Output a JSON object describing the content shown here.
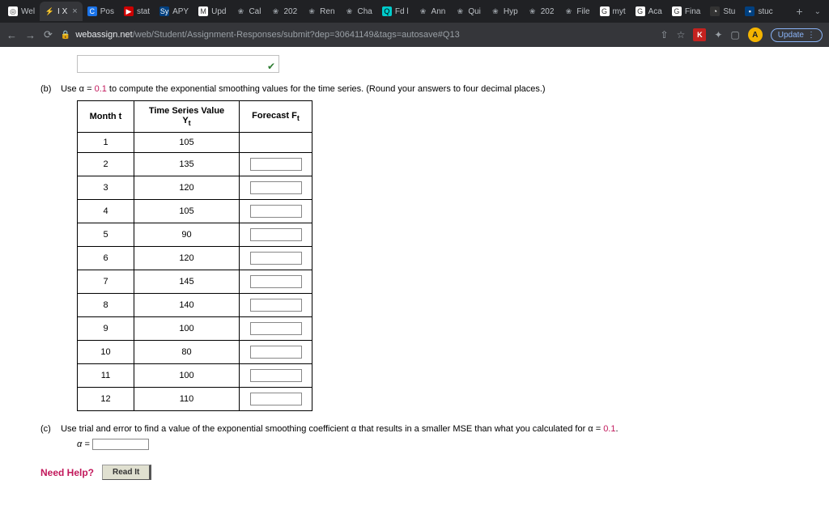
{
  "tabs": [
    {
      "fav": "fav-white",
      "icon": "◎",
      "label": "Wel",
      "active": false,
      "close": false
    },
    {
      "fav": "fav-none",
      "icon": "⚡",
      "label": "I X",
      "active": true,
      "close": true
    },
    {
      "fav": "fav-blue",
      "icon": "C",
      "label": "Pos",
      "active": false,
      "close": false
    },
    {
      "fav": "fav-red",
      "icon": "▶",
      "label": "stat",
      "active": false,
      "close": false
    },
    {
      "fav": "fav-navy",
      "icon": "Sy",
      "label": "APY",
      "active": false,
      "close": false
    },
    {
      "fav": "fav-white",
      "icon": "M",
      "label": "Upd",
      "active": false,
      "close": false
    },
    {
      "fav": "fav-none",
      "icon": "❀",
      "label": "Cal",
      "active": false,
      "close": false
    },
    {
      "fav": "fav-none",
      "icon": "❀",
      "label": "202",
      "active": false,
      "close": false
    },
    {
      "fav": "fav-none",
      "icon": "❀",
      "label": "Ren",
      "active": false,
      "close": false
    },
    {
      "fav": "fav-none",
      "icon": "❀",
      "label": "Cha",
      "active": false,
      "close": false
    },
    {
      "fav": "fav-cyan",
      "icon": "Q",
      "label": "Fd l",
      "active": false,
      "close": false
    },
    {
      "fav": "fav-none",
      "icon": "❀",
      "label": "Ann",
      "active": false,
      "close": false
    },
    {
      "fav": "fav-none",
      "icon": "❀",
      "label": "Qui",
      "active": false,
      "close": false
    },
    {
      "fav": "fav-none",
      "icon": "❀",
      "label": "Hyp",
      "active": false,
      "close": false
    },
    {
      "fav": "fav-none",
      "icon": "❀",
      "label": "202",
      "active": false,
      "close": false
    },
    {
      "fav": "fav-none",
      "icon": "❀",
      "label": "File",
      "active": false,
      "close": false
    },
    {
      "fav": "fav-white",
      "icon": "G",
      "label": "myt",
      "active": false,
      "close": false
    },
    {
      "fav": "fav-white",
      "icon": "G",
      "label": "Aca",
      "active": false,
      "close": false
    },
    {
      "fav": "fav-white",
      "icon": "G",
      "label": "Fina",
      "active": false,
      "close": false
    },
    {
      "fav": "fav-dark",
      "icon": "◔",
      "label": "Stu",
      "active": false,
      "close": false
    },
    {
      "fav": "fav-navy",
      "icon": "▪",
      "label": "stuc",
      "active": false,
      "close": false
    }
  ],
  "newtab": "+",
  "chevron": "⌄",
  "nav": {
    "back": "←",
    "forward": "→",
    "reload": "⟳"
  },
  "url": {
    "lock": "🔒",
    "host": "webassign.net",
    "path": "/web/Student/Assignment-Responses/submit?dep=30641149&tags=autosave#Q13"
  },
  "toolbar": {
    "share": "⇧",
    "star": "☆",
    "ext": "K",
    "puzzle": "✦",
    "window": "▢",
    "profile": "A",
    "update": "Update",
    "menu": "⋮"
  },
  "partb": {
    "label": "(b)",
    "text_pre": "Use α = ",
    "alpha": "0.1",
    "text_post": " to compute the exponential smoothing values for the time series. (Round your answers to four decimal places.)",
    "headers": {
      "month": "Month t",
      "value_l1": "Time Series Value",
      "value_l2": "Y",
      "value_sub": "t",
      "forecast": "Forecast F",
      "forecast_sub": "t"
    },
    "rows": [
      {
        "t": "1",
        "y": "105",
        "input": false
      },
      {
        "t": "2",
        "y": "135",
        "input": true
      },
      {
        "t": "3",
        "y": "120",
        "input": true
      },
      {
        "t": "4",
        "y": "105",
        "input": true
      },
      {
        "t": "5",
        "y": "90",
        "input": true
      },
      {
        "t": "6",
        "y": "120",
        "input": true
      },
      {
        "t": "7",
        "y": "145",
        "input": true
      },
      {
        "t": "8",
        "y": "140",
        "input": true
      },
      {
        "t": "9",
        "y": "100",
        "input": true
      },
      {
        "t": "10",
        "y": "80",
        "input": true
      },
      {
        "t": "11",
        "y": "100",
        "input": true
      },
      {
        "t": "12",
        "y": "110",
        "input": true
      }
    ]
  },
  "partc": {
    "label": "(c)",
    "text_pre": "Use trial and error to find a value of the exponential smoothing coefficient α that results in a smaller MSE than what you calculated for α = ",
    "alpha": "0.1",
    "period": ".",
    "eq": "α ="
  },
  "help": {
    "label": "Need Help?",
    "readit": "Read It"
  },
  "check": "✔"
}
